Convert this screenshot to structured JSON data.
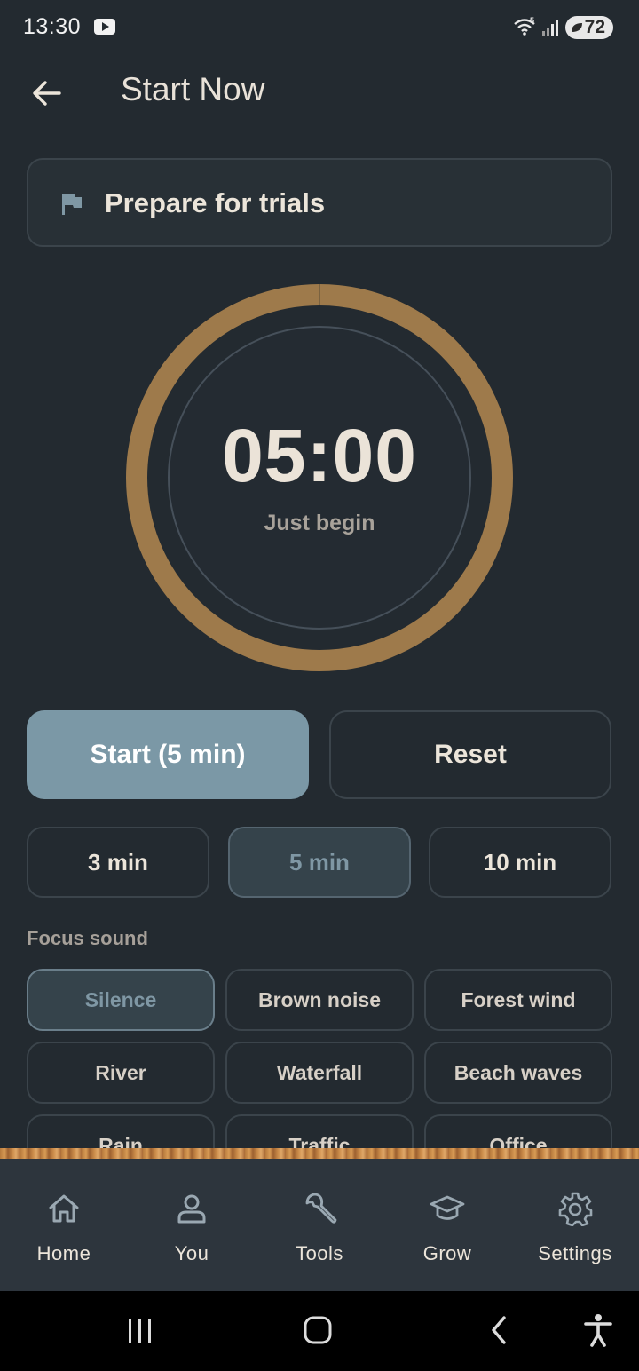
{
  "status_bar": {
    "time": "13:30",
    "battery": "72"
  },
  "app_bar": {
    "title": "Start Now"
  },
  "task": {
    "title": "Prepare for trials"
  },
  "timer": {
    "time": "05:00",
    "subtitle": "Just begin",
    "progress": 0.0,
    "ring_color": "#9e7a4b"
  },
  "actions": {
    "start_label": "Start (5 min)",
    "reset_label": "Reset"
  },
  "durations": [
    {
      "label": "3 min",
      "selected": false
    },
    {
      "label": "5 min",
      "selected": true
    },
    {
      "label": "10 min",
      "selected": false
    }
  ],
  "focus_sound": {
    "label": "Focus sound",
    "options": [
      {
        "label": "Silence",
        "selected": true
      },
      {
        "label": "Brown noise",
        "selected": false
      },
      {
        "label": "Forest wind",
        "selected": false
      },
      {
        "label": "River",
        "selected": false
      },
      {
        "label": "Waterfall",
        "selected": false
      },
      {
        "label": "Beach waves",
        "selected": false
      },
      {
        "label": "Rain",
        "selected": false
      },
      {
        "label": "Traffic",
        "selected": false
      },
      {
        "label": "Office",
        "selected": false
      }
    ]
  },
  "bottom_nav": [
    {
      "label": "Home",
      "icon": "home-icon"
    },
    {
      "label": "You",
      "icon": "person-icon"
    },
    {
      "label": "Tools",
      "icon": "wrench-icon"
    },
    {
      "label": "Grow",
      "icon": "graduation-cap-icon"
    },
    {
      "label": "Settings",
      "icon": "gear-icon"
    }
  ],
  "colors": {
    "background": "#232a30",
    "accent": "#7b98a6",
    "ring": "#9e7a4b"
  }
}
